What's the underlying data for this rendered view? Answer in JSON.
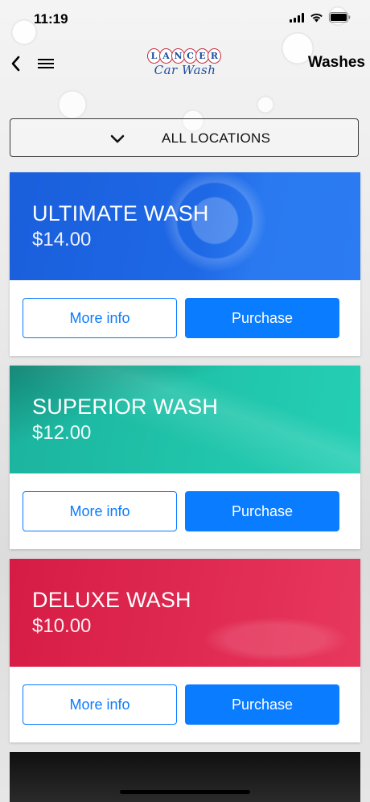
{
  "status_bar": {
    "time": "11:19"
  },
  "nav": {
    "title": "Washes",
    "logo": {
      "top_letters": [
        "L",
        "A",
        "N",
        "C",
        "E",
        "R"
      ],
      "bottom_text": "Car Wash"
    }
  },
  "location_filter": {
    "label": "ALL LOCATIONS"
  },
  "washes": [
    {
      "name": "ULTIMATE WASH",
      "price": "$14.00",
      "color": "#1e68e6",
      "more_info_label": "More info",
      "purchase_label": "Purchase"
    },
    {
      "name": "SUPERIOR WASH",
      "price": "$12.00",
      "color": "#20c4aa",
      "more_info_label": "More info",
      "purchase_label": "Purchase"
    },
    {
      "name": "DELUXE WASH",
      "price": "$10.00",
      "color": "#e02a52",
      "more_info_label": "More info",
      "purchase_label": "Purchase"
    }
  ],
  "colors": {
    "accent": "#0a7cff",
    "logo_blue": "#1b4fa0",
    "logo_red": "#c8283a"
  },
  "icons": {
    "back": "chevron-left-icon",
    "menu": "hamburger-menu-icon",
    "dropdown": "chevron-down-icon",
    "signal": "cellular-signal-icon",
    "wifi": "wifi-icon",
    "battery": "battery-icon"
  }
}
